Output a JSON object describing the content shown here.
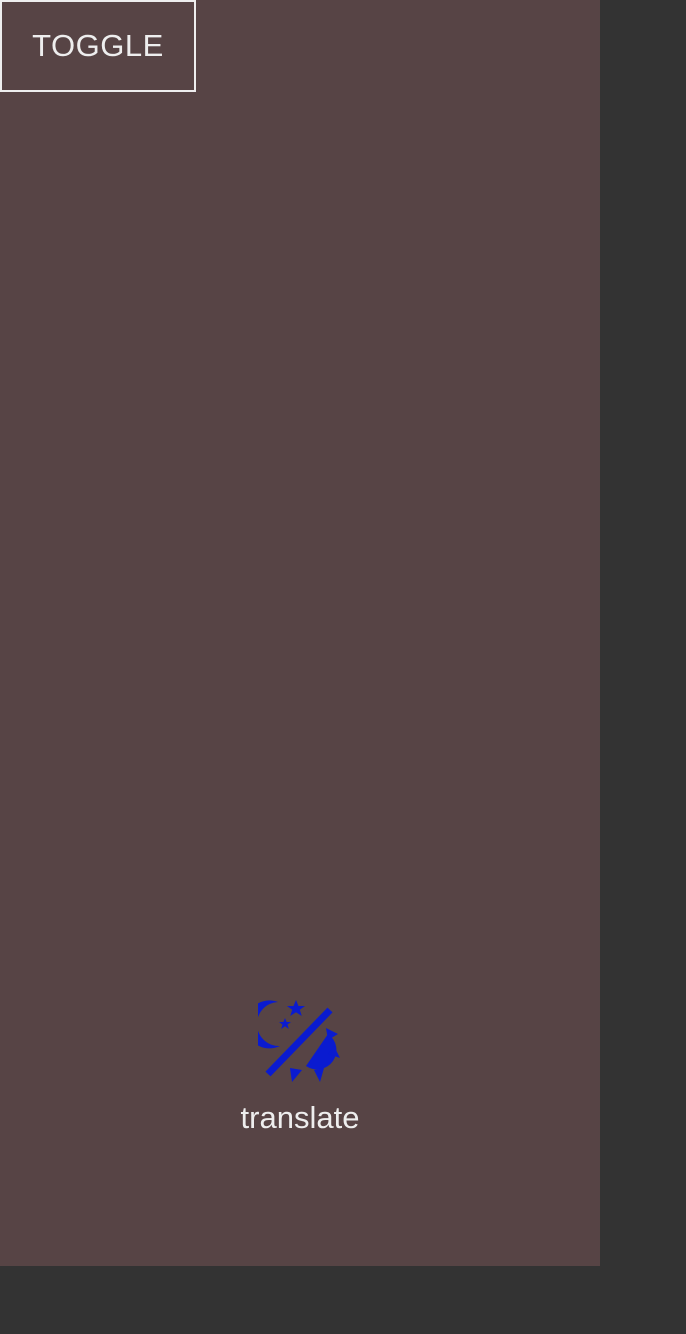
{
  "toggle": {
    "label": "TOGGLE"
  },
  "theme_icon": {
    "name": "day-night-toggle-icon",
    "color": "#0a1bd0"
  },
  "caption": {
    "text": "translate"
  },
  "colors": {
    "page_background": "#333333",
    "panel_background": "#574445",
    "text": "#eeeeee",
    "icon": "#0a1bd0"
  }
}
